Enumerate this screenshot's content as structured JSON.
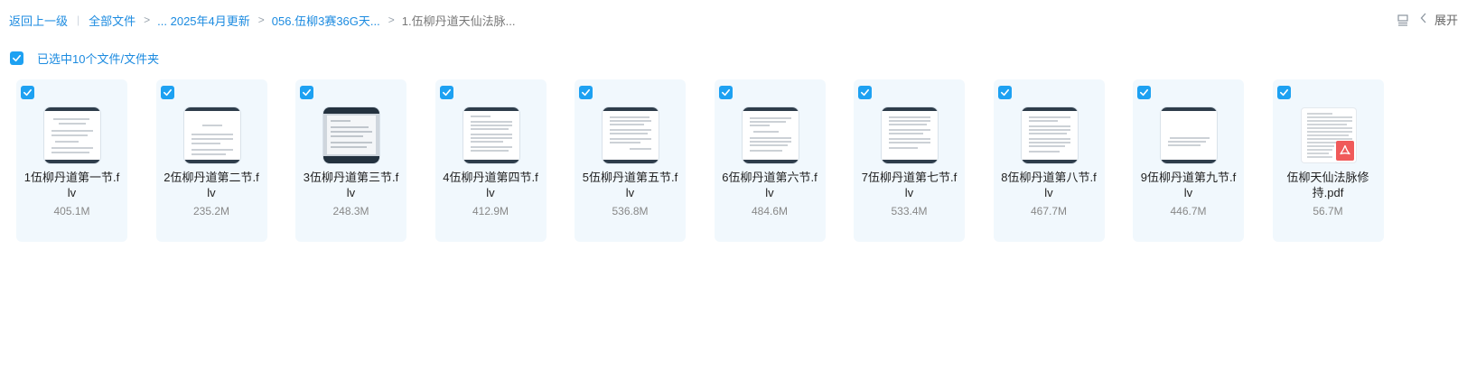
{
  "breadcrumb": {
    "back": "返回上一级",
    "all_files": "全部文件",
    "items": [
      "... 2025年4月更新",
      "056.伍柳3赛36G天..."
    ],
    "current": "1.伍柳丹道天仙法脉..."
  },
  "toolbar": {
    "expand_label": "展开",
    "list_icon": "list-view-icon",
    "chevron_icon": "chevron-left-icon"
  },
  "selection": {
    "label": "已选中10个文件/文件夹",
    "checked": true
  },
  "colors": {
    "accent": "#1da1f2",
    "card_bg": "#f1f8fd",
    "pdf_red": "#f05a5a"
  },
  "files": [
    {
      "name": "1伍柳丹道第一节.flv",
      "size": "405.1M",
      "type": "video"
    },
    {
      "name": "2伍柳丹道第二节.flv",
      "size": "235.2M",
      "type": "video"
    },
    {
      "name": "3伍柳丹道第三节.flv",
      "size": "248.3M",
      "type": "video-dark"
    },
    {
      "name": "4伍柳丹道第四节.flv",
      "size": "412.9M",
      "type": "video"
    },
    {
      "name": "5伍柳丹道第五节.flv",
      "size": "536.8M",
      "type": "video"
    },
    {
      "name": "6伍柳丹道第六节.flv",
      "size": "484.6M",
      "type": "video"
    },
    {
      "name": "7伍柳丹道第七节.flv",
      "size": "533.4M",
      "type": "video"
    },
    {
      "name": "8伍柳丹道第八节.flv",
      "size": "467.7M",
      "type": "video"
    },
    {
      "name": "9伍柳丹道第九节.flv",
      "size": "446.7M",
      "type": "video"
    },
    {
      "name": "伍柳天仙法脉修持.pdf",
      "size": "56.7M",
      "type": "pdf"
    }
  ]
}
